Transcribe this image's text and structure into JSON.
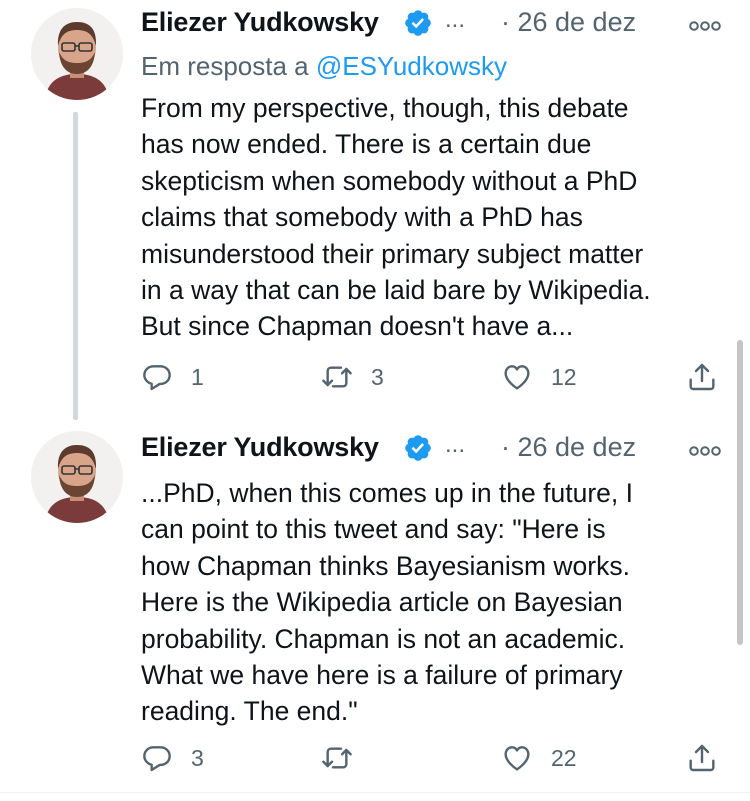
{
  "tweets": [
    {
      "author": "Eliezer Yudkowsky",
      "verified": true,
      "truncation": "...",
      "date": "· 26 de dez",
      "reply_to_prefix": "Em resposta a ",
      "reply_to_handle": "@ESYudkowsky",
      "body_lines": [
        "From my perspective, though, this debate",
        "has now ended.  There is a certain due",
        "skepticism when somebody without a PhD",
        "claims that somebody with a PhD has",
        "misunderstood their primary subject matter",
        "in a way that can be laid bare by Wikipedia.",
        "But since Chapman doesn't have a..."
      ],
      "actions": {
        "replies": "1",
        "retweets": "3",
        "likes": "12"
      }
    },
    {
      "author": "Eliezer Yudkowsky",
      "verified": true,
      "truncation": "...",
      "date": "· 26 de dez",
      "body_lines": [
        "...PhD, when this comes up in the future, I",
        "can point to this tweet and say:  \"Here is",
        "how Chapman thinks Bayesianism works.",
        "Here is the Wikipedia article on Bayesian",
        "probability.  Chapman is not an academic.",
        "What we have here is a failure of primary",
        "reading.  The end.\""
      ],
      "actions": {
        "replies": "3",
        "retweets": "",
        "likes": "22"
      }
    }
  ],
  "icons": {
    "verified": "verified-badge-icon",
    "more": "more-options-icon",
    "reply": "reply-icon",
    "retweet": "retweet-icon",
    "like": "heart-icon",
    "share": "share-icon"
  },
  "colors": {
    "text": "#0f1419",
    "secondary": "#536471",
    "accent": "#1d9bf0",
    "thread_line": "#cfd9de"
  }
}
